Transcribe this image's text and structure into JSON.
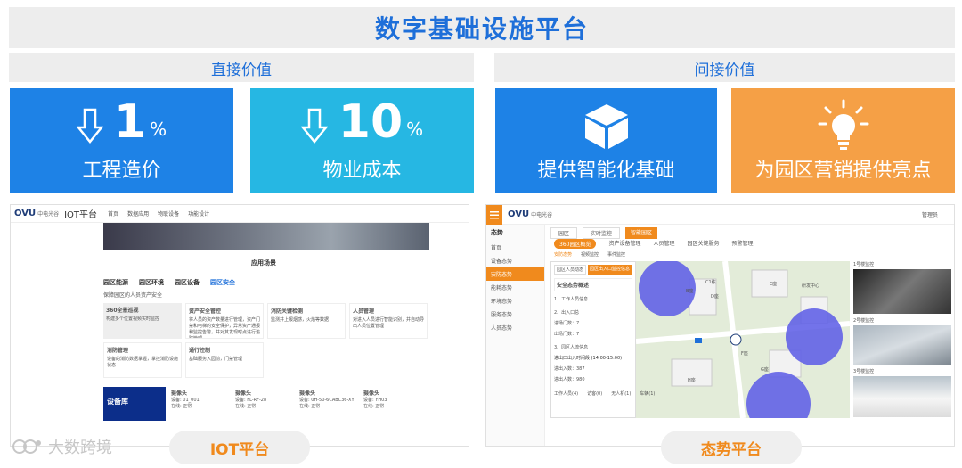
{
  "banner": {
    "title": "数字基础设施平台"
  },
  "sections": {
    "direct": "直接价值",
    "indirect": "间接价值"
  },
  "cards": {
    "c1": {
      "value": "1",
      "unit": "%",
      "label": "工程造价",
      "color": "#1e82e6"
    },
    "c2": {
      "value": "10",
      "unit": "%",
      "label": "物业成本",
      "color": "#26b7e3"
    },
    "c3": {
      "label": "提供智能化基础",
      "color": "#1e82e6"
    },
    "c4": {
      "label": "为园区营销提供亮点",
      "color": "#f5a046"
    }
  },
  "iot": {
    "brand": "中电光谷",
    "logo": "OVU",
    "platform": "IOT平台",
    "nav": [
      "首页",
      "数据应用",
      "物联设备",
      "功能设计"
    ],
    "hero_title": "应用场景",
    "tabs": [
      "园区能源",
      "园区环境",
      "园区设备",
      "园区安全"
    ],
    "tab_desc": "保障园区的人员资产安全",
    "features": [
      {
        "title": "360全景巡视",
        "desc": "构建多个位置视频实时监控"
      },
      {
        "title": "资产安全管控",
        "desc": "将人员的资产数量进行管理，资产门禁和电梯的安全保护，异常资产通报和监控告警，并对其发现时点进行追踪管理"
      },
      {
        "title": "消防关键检测",
        "desc": "监测并上报烟感，火焰等数据"
      },
      {
        "title": "人员管理",
        "desc": "对进入人员进行智能识别，并自动导出人员位置管理"
      },
      {
        "title": "消防管理",
        "desc": "设备的消防数据掌握，掌控消防设施状态"
      },
      {
        "title": "通行控制",
        "desc": "基础服务入园前，门禁管理"
      }
    ],
    "footer_title": "设备库",
    "devices": [
      {
        "name": "摄像头",
        "id": "设备: 01_001",
        "status": "在线: 正常"
      },
      {
        "name": "摄像头",
        "id": "设备: FL-RF-28",
        "status": "在线: 正常"
      },
      {
        "name": "摄像头",
        "id": "设备: 0H-50-6CABC36-XY",
        "status": "在线: 正常"
      },
      {
        "name": "摄像头",
        "id": "设备: YH03",
        "status": "在线: 正常"
      }
    ],
    "pill": "IOT平台"
  },
  "situation": {
    "logo": "OVU",
    "brand": "中电光谷",
    "side_title": "态势",
    "side_items": [
      "首页",
      "设备态势",
      "安防态势",
      "能耗态势",
      "环境态势",
      "服务态势",
      "人员态势"
    ],
    "top_items": [
      "园区",
      "实时监控",
      "智能园区"
    ],
    "tabs": [
      "360园区概览",
      "资产设备管理",
      "人员管理",
      "园区关键服务",
      "预警管理"
    ],
    "sub_tabs": [
      "安防态势",
      "视频监控",
      "事件监控"
    ],
    "panel_tabs": [
      "园区人员动态",
      "园区出入口监控信息"
    ],
    "panel_title": "安全态势概述",
    "panel_items": [
      "1、工作人员信息",
      "2、出入口总",
      "进场门数：7",
      "出场门数：7",
      "3、园区人流信息",
      "进出口出入时间段 (14:00-15:00)",
      "进出入数：387",
      "进出人数：980"
    ],
    "map_labels": [
      "C1栋",
      "B座",
      "D座",
      "E座",
      "F座",
      "G座",
      "H座",
      "研发中心"
    ],
    "legend": [
      "工作人员(4)",
      "访客(0)",
      "无人机(1)",
      "车辆(1)"
    ],
    "cams": [
      "1号楼监控",
      "2号楼监控",
      "3号楼监控"
    ],
    "user": "管理员",
    "pill": "态势平台"
  },
  "watermark": "大数跨境"
}
